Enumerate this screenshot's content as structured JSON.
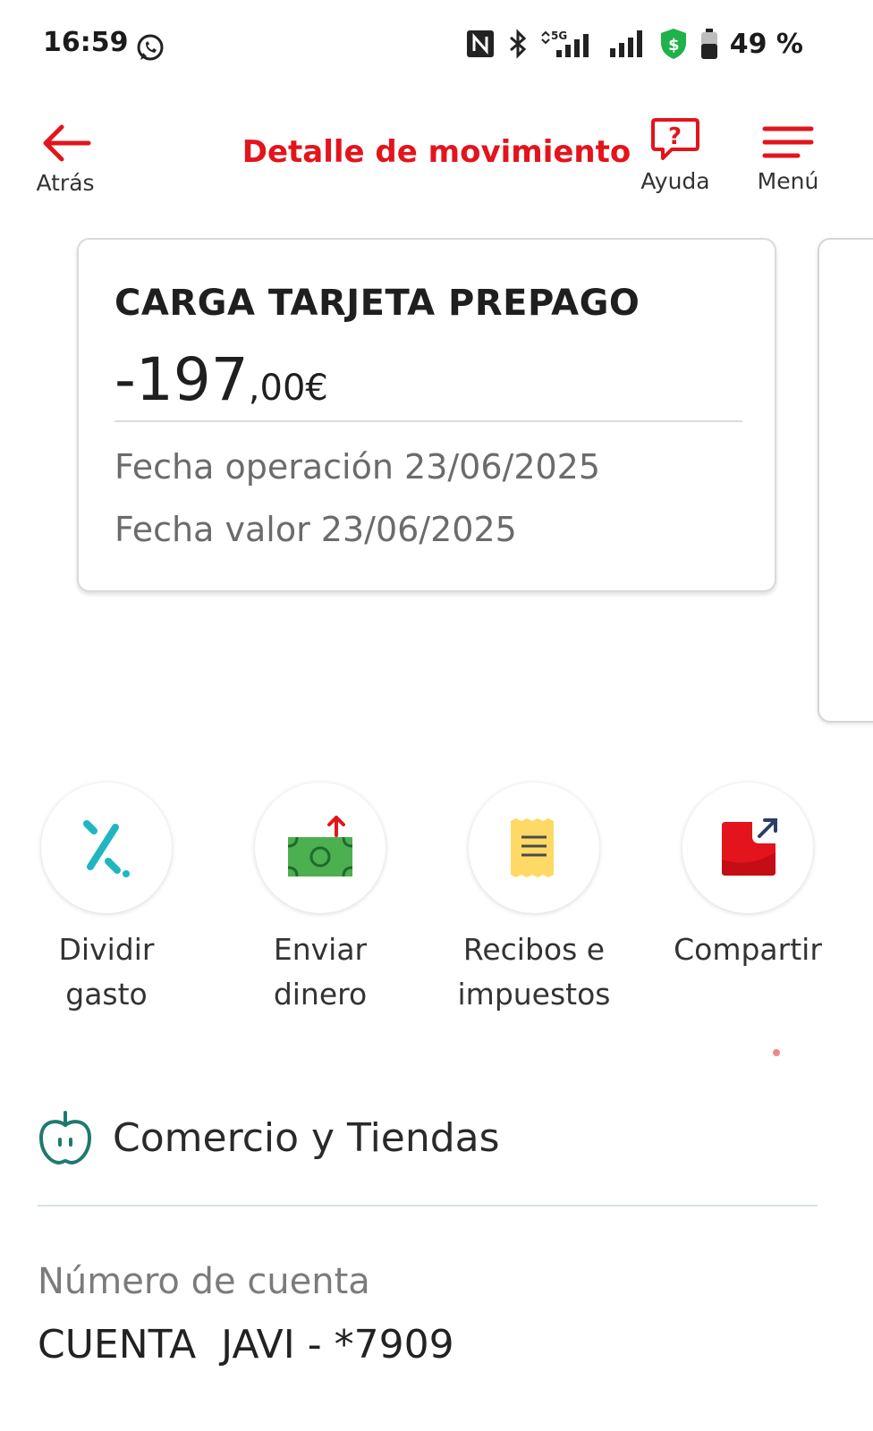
{
  "status_bar": {
    "time": "16:59",
    "network": "5G",
    "battery": "49 %",
    "icons": [
      "whatsapp-icon",
      "nfc-icon",
      "bluetooth-icon",
      "5g-signal-icon",
      "signal-icon",
      "security-shield-icon",
      "battery-icon"
    ]
  },
  "header": {
    "back_label": "Atrás",
    "title": "Detalle de movimiento",
    "help_label": "Ayuda",
    "menu_label": "Menú",
    "accent": "#e3141c"
  },
  "movement": {
    "title": "CARGA TARJETA PREPAGO",
    "amount_int": "-197",
    "amount_dec": ",00€",
    "operation_date": "Fecha operación 23/06/2025",
    "value_date": "Fecha valor 23/06/2025"
  },
  "actions": [
    {
      "label_line1": "Dividir",
      "label_line2": "gasto",
      "icon": "split-expense-icon"
    },
    {
      "label_line1": "Enviar",
      "label_line2": "dinero",
      "icon": "send-money-icon"
    },
    {
      "label_line1": "Recibos e",
      "label_line2": "impuestos",
      "icon": "receipt-icon"
    },
    {
      "label_line1": "Compartir",
      "label_line2": "",
      "icon": "share-icon"
    }
  ],
  "category": {
    "label": "Comercio y Tiendas",
    "icon": "apple-icon",
    "color": "#1f7a6e"
  },
  "account": {
    "label": "Número de cuenta",
    "value": "CUENTA  JAVI - *7909"
  }
}
